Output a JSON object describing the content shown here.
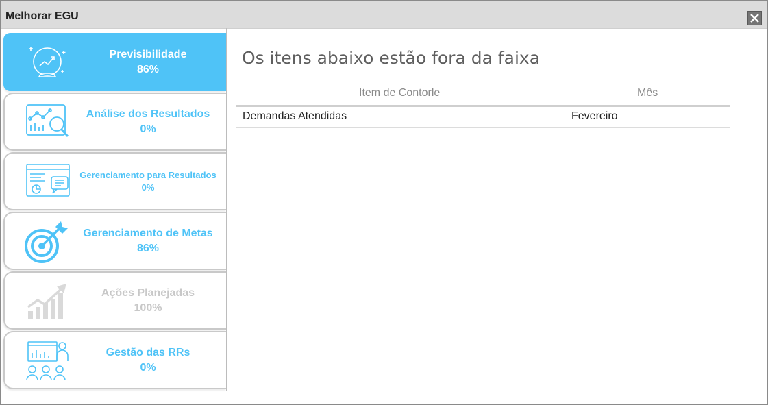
{
  "window": {
    "title": "Melhorar EGU"
  },
  "sidebar": {
    "items": [
      {
        "label": "Previsibilidade",
        "percent": "86%",
        "icon": "crystal-ball-chart-icon",
        "state": "active"
      },
      {
        "label": "Análise dos Resultados",
        "percent": "0%",
        "icon": "analytics-magnifier-icon",
        "state": "normal"
      },
      {
        "label": "Gerenciamento para Resultados",
        "percent": "0%",
        "icon": "dashboard-report-icon",
        "state": "normal"
      },
      {
        "label": "Gerenciamento de Metas",
        "percent": "86%",
        "icon": "target-arrow-icon",
        "state": "normal"
      },
      {
        "label": "Ações Planejadas",
        "percent": "100%",
        "icon": "growth-chart-icon",
        "state": "disabled"
      },
      {
        "label": "Gestão das RRs",
        "percent": "0%",
        "icon": "team-presentation-icon",
        "state": "normal"
      }
    ]
  },
  "main": {
    "heading": "Os itens abaixo estão fora da faixa",
    "table": {
      "columns": [
        "Item de Contorle",
        "Mês"
      ],
      "rows": [
        [
          "Demandas Atendidas",
          "Fevereiro"
        ]
      ]
    }
  },
  "colors": {
    "accent": "#4fc3f7",
    "disabled": "#c8c8c8",
    "titlebar": "#dcdcdc"
  }
}
